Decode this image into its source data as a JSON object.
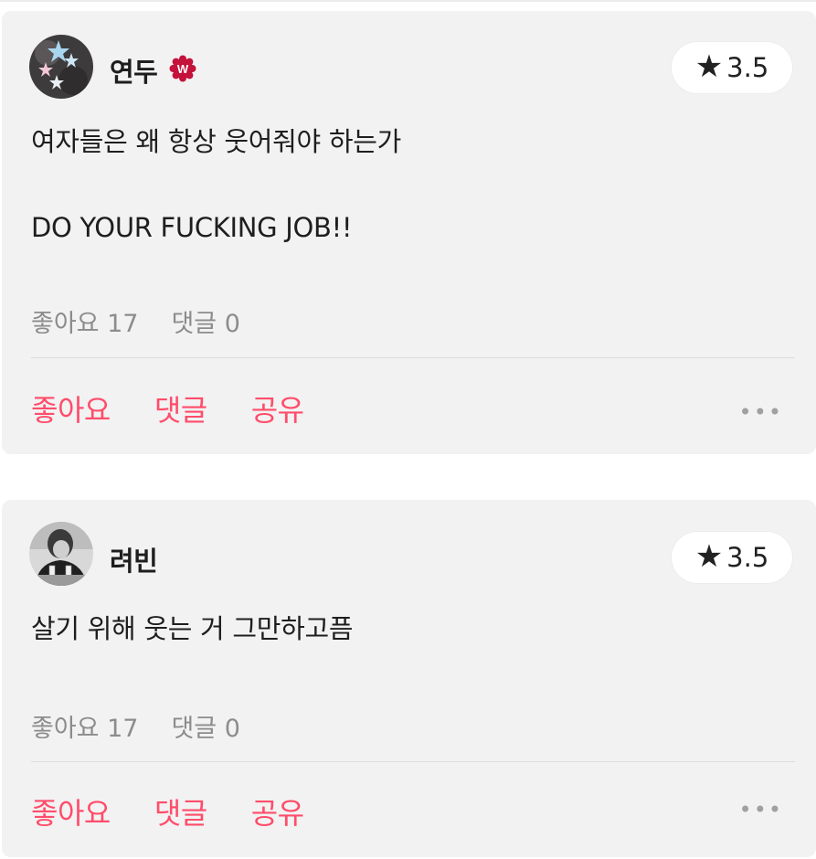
{
  "reviews": [
    {
      "username": "연두",
      "has_badge": true,
      "badge_letter": "W",
      "rating": "3.5",
      "star_icon": "★",
      "comment_lines": [
        "여자들은 왜 항상 웃어줘야 하는가",
        "DO YOUR FUCKING JOB!!"
      ],
      "likes_text": "좋아요 17",
      "comments_text": "댓글 0",
      "actions": {
        "like": "좋아요",
        "comment": "댓글",
        "share": "공유"
      },
      "more_icon": "•••"
    },
    {
      "username": "려빈",
      "has_badge": false,
      "rating": "3.5",
      "star_icon": "★",
      "comment_lines": [
        "살기 위해 웃는 거 그만하고픔"
      ],
      "likes_text": "좋아요 17",
      "comments_text": "댓글 0",
      "actions": {
        "like": "좋아요",
        "comment": "댓글",
        "share": "공유"
      },
      "more_icon": "•••"
    }
  ],
  "colors": {
    "accent": "#ff4d6a",
    "card_bg": "#f2f2f3",
    "muted_text": "#8c8c8c",
    "badge": "#c4123a"
  }
}
